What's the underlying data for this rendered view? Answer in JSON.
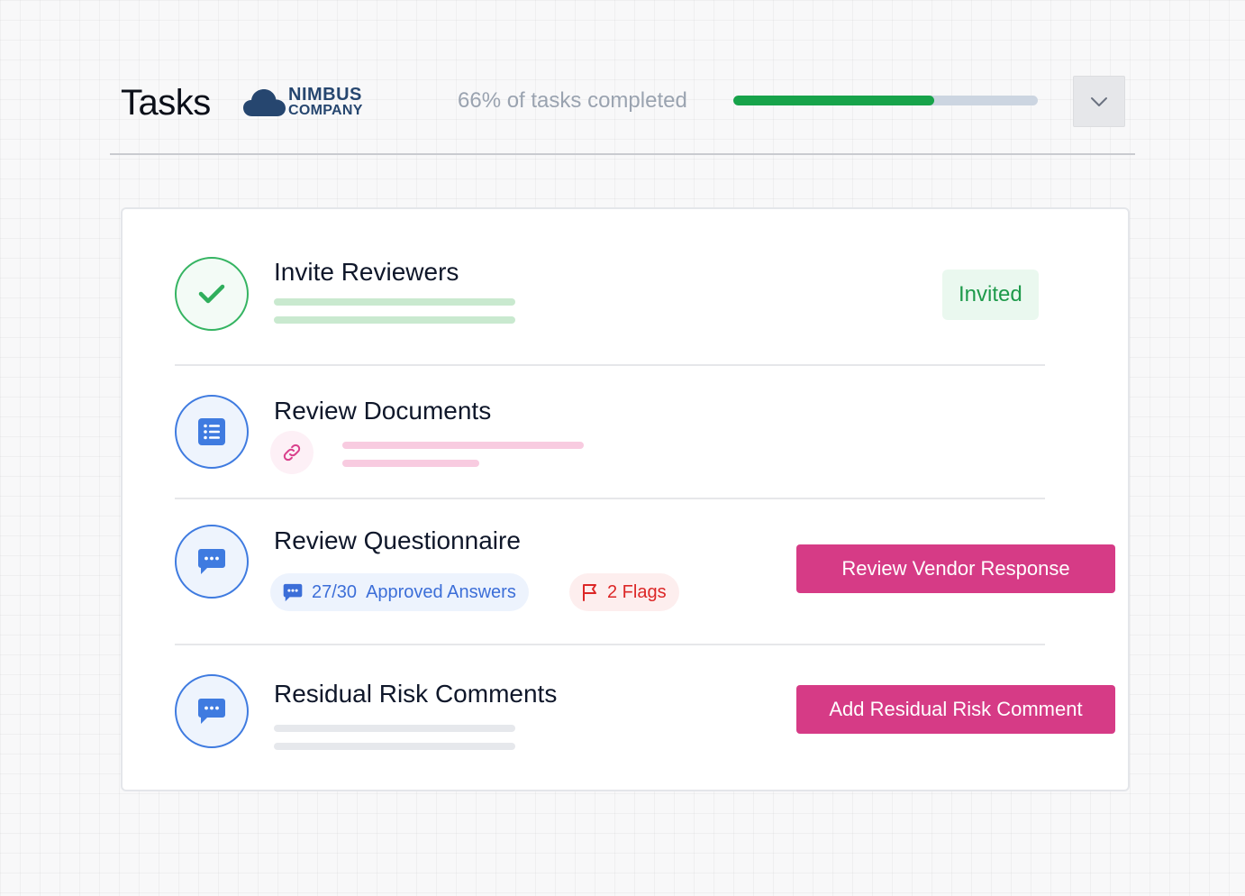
{
  "header": {
    "title": "Tasks",
    "logo": {
      "line1": "NIMBUS",
      "line2": "COMPANY",
      "icon": "cloud-icon"
    },
    "progress": {
      "label": "66% of tasks completed",
      "percent": 66,
      "color": "#17a34a"
    },
    "dropdown_icon": "chevron-down-icon"
  },
  "tasks": [
    {
      "title": "Invite Reviewers",
      "status": "done",
      "icon": "check-icon",
      "badge": "Invited"
    },
    {
      "title": "Review Documents",
      "status": "pending",
      "icon": "list-icon",
      "link_icon": "link-icon"
    },
    {
      "title": "Review Questionnaire",
      "status": "pending",
      "icon": "chat-icon",
      "answers": {
        "count": "27/30",
        "label": "Approved Answers"
      },
      "flags": "2 Flags",
      "action": "Review Vendor Response"
    },
    {
      "title": "Residual Risk Comments",
      "status": "pending",
      "icon": "chat-icon",
      "action": "Add Residual Risk Comment"
    }
  ],
  "colors": {
    "accent": "#d63b86",
    "success": "#17a34a",
    "primary": "#3f7be0",
    "danger": "#dc2626",
    "brand": "#26466f"
  }
}
